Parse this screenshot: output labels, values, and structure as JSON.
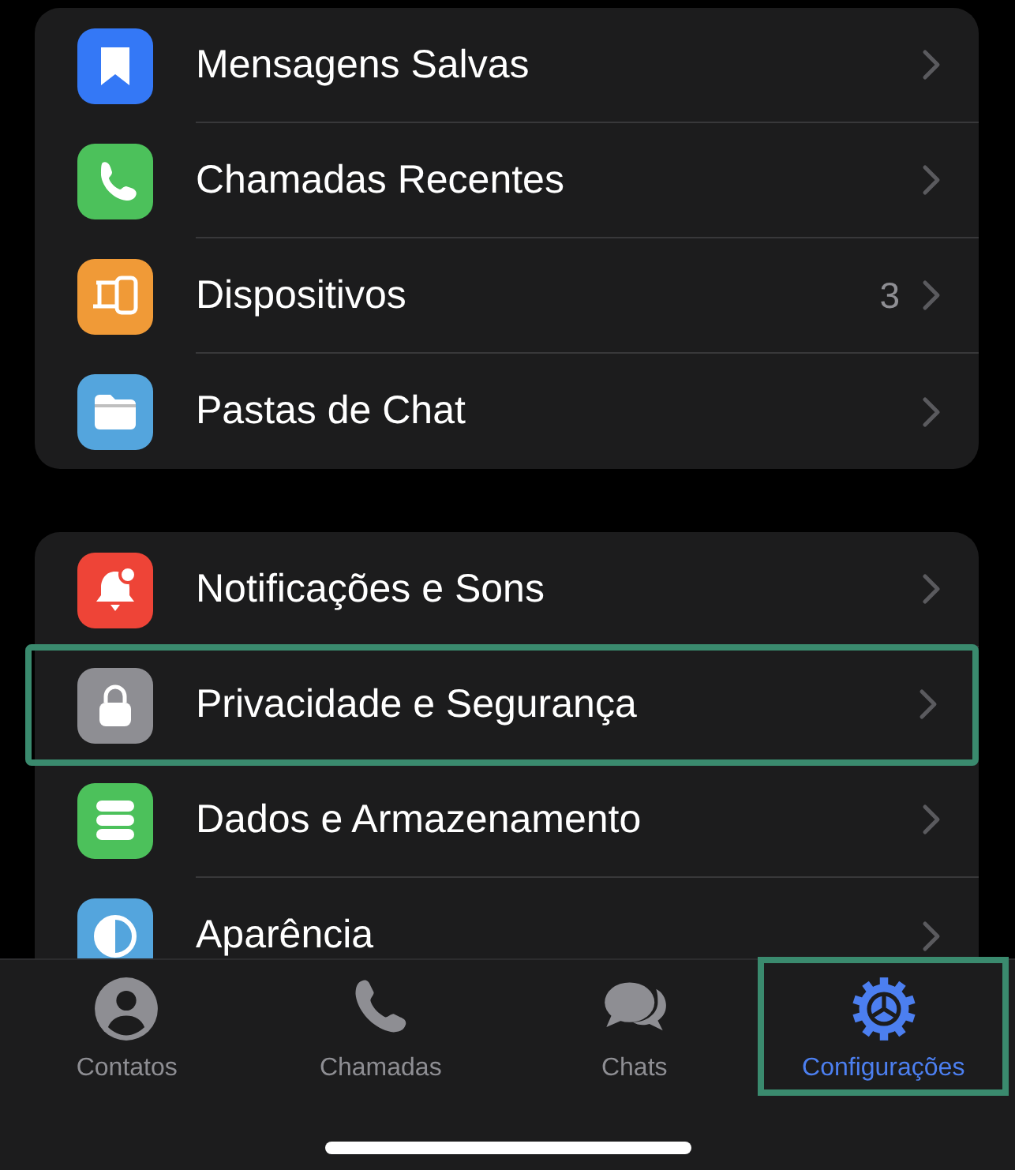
{
  "groups": [
    {
      "items": [
        {
          "kind": "bookmark",
          "color": "#3478f6",
          "label": "Mensagens Salvas",
          "highlighted": false
        },
        {
          "kind": "phone",
          "color": "#4cc15b",
          "label": "Chamadas Recentes",
          "highlighted": false
        },
        {
          "kind": "devices",
          "color": "#f09a37",
          "label": "Dispositivos",
          "count": "3",
          "highlighted": false
        },
        {
          "kind": "folder",
          "color": "#54a5dd",
          "label": "Pastas de Chat",
          "highlighted": false
        }
      ]
    },
    {
      "items": [
        {
          "kind": "bell",
          "color": "#ee4437",
          "label": "Notificações e Sons",
          "highlighted": false
        },
        {
          "kind": "lock",
          "color": "#8e8e93",
          "label": "Privacidade e Segurança",
          "highlighted": true
        },
        {
          "kind": "database",
          "color": "#4cc15b",
          "label": "Dados e Armazenamento",
          "highlighted": false
        },
        {
          "kind": "contrast",
          "color": "#54a5dd",
          "label": "Aparência",
          "highlighted": false
        }
      ]
    }
  ],
  "tab_bar": [
    {
      "kind": "person",
      "label": "Contatos",
      "selected": false,
      "highlighted": false
    },
    {
      "kind": "phone",
      "label": "Chamadas",
      "selected": false,
      "highlighted": false
    },
    {
      "kind": "chats",
      "label": "Chats",
      "selected": false,
      "highlighted": false
    },
    {
      "kind": "gear",
      "label": "Configurações",
      "selected": true,
      "highlighted": true
    }
  ]
}
